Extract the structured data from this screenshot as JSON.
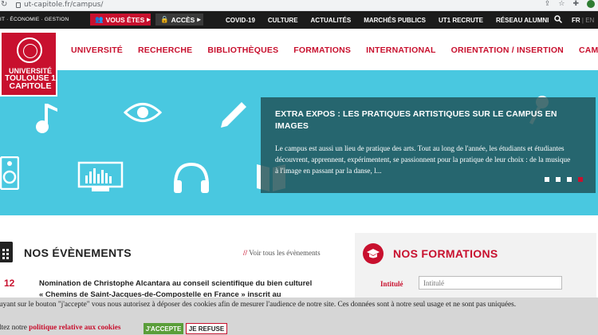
{
  "browser": {
    "url": "ut-capitole.fr/campus/"
  },
  "topbar": {
    "crumb": "IT · ÉCONOMIE · GESTION",
    "vous_etes": "VOUS ÊTES",
    "acces": "ACCÈS",
    "links": [
      "COVID-19",
      "CULTURE",
      "ACTUALITÉS",
      "MARCHÉS PUBLICS",
      "UT1 RECRUTE",
      "RÉSEAU ALUMNI"
    ],
    "lang_fr": "FR",
    "lang_en": "EN"
  },
  "logo": {
    "line1": "UNIVERSITÉ",
    "line2": "TOULOUSE 1",
    "line3": "CAPITOLE"
  },
  "nav": [
    "UNIVERSITÉ",
    "RECHERCHE",
    "BIBLIOTHÈQUES",
    "FORMATIONS",
    "INTERNATIONAL",
    "ORIENTATION / INSERTION",
    "CAMPUS"
  ],
  "hero": {
    "title": "EXTRA EXPOS : LES PRATIQUES ARTISTIQUES SUR LE CAMPUS EN IMAGES",
    "text": "Le campus est aussi un lieu de pratique des arts. Tout au long de l'année, les étudiants et étudiantes découvrent, apprennent, expérimentent, se passionnent pour la pratique de leur choix : de la musique à l'image en passant par la danse, l...",
    "slides": 4,
    "active_slide": 4
  },
  "events": {
    "title": "NOS ÉVÈNEMENTS",
    "all_prefix": "//",
    "all_label": "Voir tous les évènements",
    "day": "12",
    "item_line1": "Nomination de Christophe Alcantara au conseil scientifique du bien culturel",
    "item_line2": "« Chemins de Saint-Jacques-de-Compostelle en France » inscrit au"
  },
  "formations": {
    "title": "NOS FORMATIONS",
    "label": "Intitulé",
    "placeholder": "Intitulé"
  },
  "cookie": {
    "text": "uyant sur le bouton \"j'accepte\" vous nous autorisez à déposer des cookies afin de mesurer l'audience de notre site. Ces données sont à notre seul usage et ne sont pas uniquées.",
    "more_prefix": "ltez notre ",
    "more_link": "politique relative aux cookies",
    "accept": "J'ACCEPTE",
    "refuse": "JE REFUSE"
  },
  "colors": {
    "brand_red": "#c8102e",
    "hero_bg": "#49c8e0",
    "topbar": "#1b1b1b"
  }
}
